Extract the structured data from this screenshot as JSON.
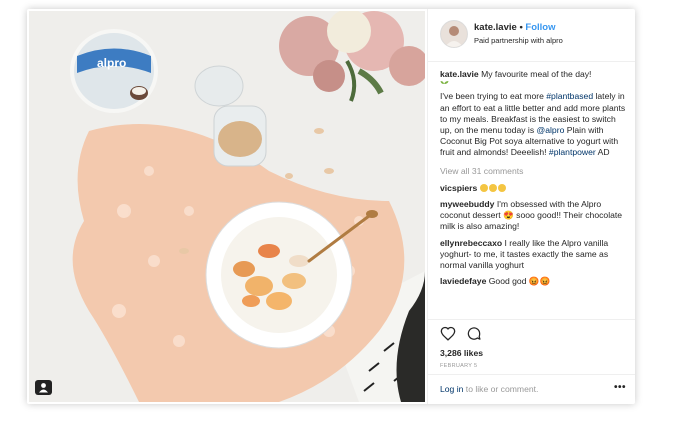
{
  "post": {
    "username": "kate.lavie",
    "separator": "•",
    "follow_label": "Follow",
    "subheading": "Paid partnership with alpro",
    "caption_user": "kate.lavie",
    "caption_line1": "My favourite meal of the day!",
    "caption_p1": "I've been trying to eat more ",
    "hashtag_plantbased": "#plantbased",
    "caption_p2": " lately in an effort to eat a little better and add more plants to my meals. Breakfast is the easiest to switch up, on the menu today is ",
    "mention_alpro": "@alpro",
    "caption_p3": " Plain with Coconut Big Pot soya alternative to yogurt with fruit and almonds! Deeelish! ",
    "hashtag_plantpower": "#plantpower",
    "caption_p4": " AD",
    "view_all": "View all 31 comments",
    "likes": "3,286 likes",
    "date": "FEBRUARY 5",
    "login_link": "Log in",
    "login_text": " to like or comment.",
    "more": "•••"
  },
  "photo": {
    "brand_text": "alpro"
  },
  "comments": [
    {
      "user": "vicspiers",
      "text": ""
    },
    {
      "user": "myweebuddy",
      "text": " I'm obsessed with the Alpro coconut dessert 😍 sooo good!! Their chocolate milk is also amazing!"
    },
    {
      "user": "ellynrebeccaxo",
      "text": " I really like the Alpro vanilla yoghurt- to me, it tastes exactly the same as normal vanilla yoghurt"
    },
    {
      "user": "laviedefaye",
      "text": " Good god 😡😡"
    }
  ],
  "colors": {
    "follow": "#3897f0",
    "link": "#003569",
    "muted": "#999999"
  },
  "icons": [
    "heart-icon",
    "comment-icon",
    "tag-user-icon",
    "more-options-icon"
  ]
}
